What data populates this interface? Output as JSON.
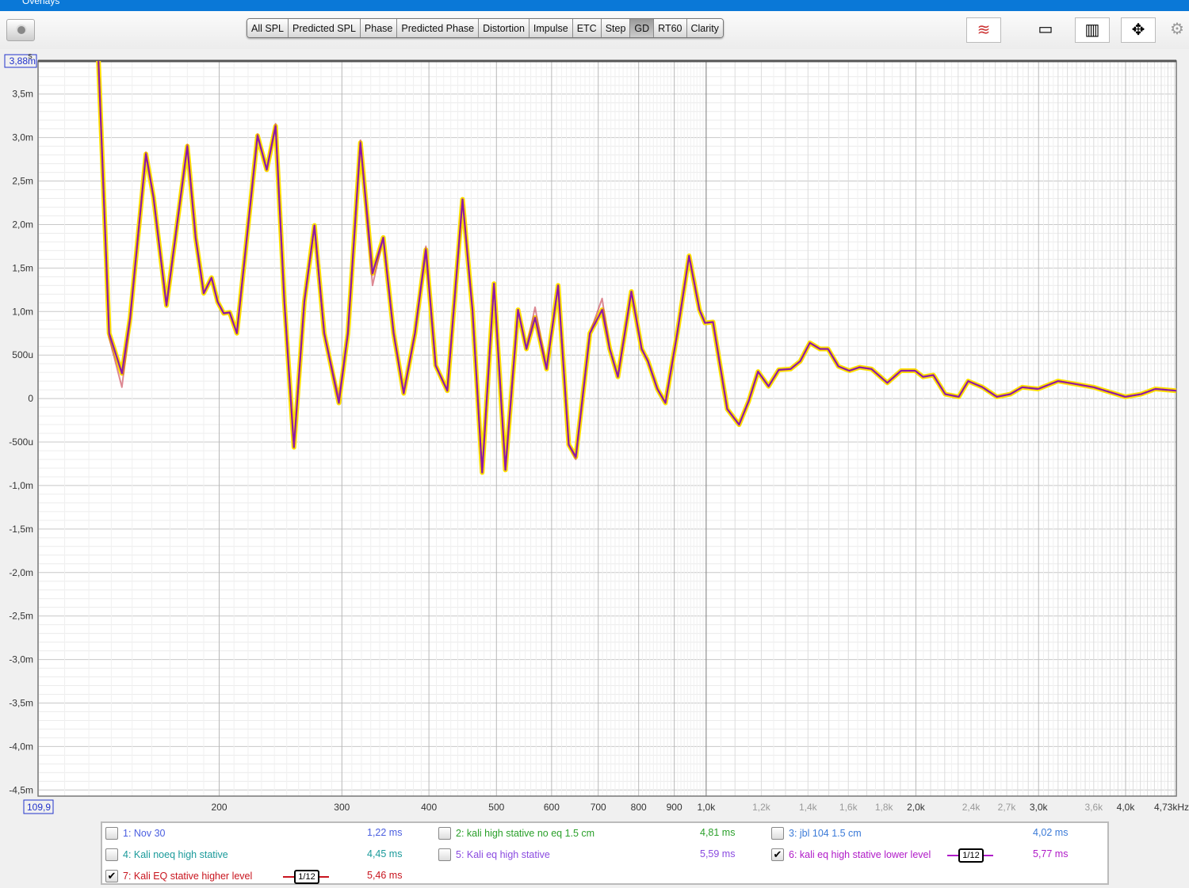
{
  "window": {
    "title": "Overlays"
  },
  "toolbar": {
    "tabs": [
      "All SPL",
      "Predicted SPL",
      "Phase",
      "Predicted Phase",
      "Distortion",
      "Impulse",
      "ETC",
      "Step",
      "GD",
      "RT60",
      "Clarity"
    ],
    "active": "GD"
  },
  "chart_data": {
    "type": "line",
    "x_scale": "log",
    "xlim": [
      109.9,
      4730
    ],
    "ylim": [
      -4.57,
      3.88
    ],
    "ylabel": "s",
    "grid": true,
    "x_ticks": [
      {
        "v": 109.9,
        "label": "109,9",
        "boxed": true
      },
      {
        "v": 200,
        "label": "200"
      },
      {
        "v": 300,
        "label": "300"
      },
      {
        "v": 400,
        "label": "400"
      },
      {
        "v": 500,
        "label": "500"
      },
      {
        "v": 600,
        "label": "600"
      },
      {
        "v": 700,
        "label": "700"
      },
      {
        "v": 800,
        "label": "800"
      },
      {
        "v": 900,
        "label": "900"
      },
      {
        "v": 1000,
        "label": "1,0k"
      },
      {
        "v": 1200,
        "label": "1,2k",
        "minor": true
      },
      {
        "v": 1400,
        "label": "1,4k",
        "minor": true
      },
      {
        "v": 1600,
        "label": "1,6k",
        "minor": true
      },
      {
        "v": 1800,
        "label": "1,8k",
        "minor": true
      },
      {
        "v": 2000,
        "label": "2,0k"
      },
      {
        "v": 2400,
        "label": "2,4k",
        "minor": true
      },
      {
        "v": 2700,
        "label": "2,7k",
        "minor": true
      },
      {
        "v": 3000,
        "label": "3,0k"
      },
      {
        "v": 3600,
        "label": "3,6k",
        "minor": true
      },
      {
        "v": 4000,
        "label": "4,0k"
      },
      {
        "v": 4730,
        "label": "4,73kHz"
      }
    ],
    "y_ticks": [
      {
        "v": 3.88,
        "label": "3,88m",
        "boxed": true
      },
      {
        "v": 3.5,
        "label": "3,5m"
      },
      {
        "v": 3.0,
        "label": "3,0m"
      },
      {
        "v": 2.5,
        "label": "2,5m"
      },
      {
        "v": 2.0,
        "label": "2,0m"
      },
      {
        "v": 1.5,
        "label": "1,5m"
      },
      {
        "v": 1.0,
        "label": "1,0m"
      },
      {
        "v": 0.5,
        "label": "500u"
      },
      {
        "v": 0,
        "label": "0"
      },
      {
        "v": -0.5,
        "label": "-500u"
      },
      {
        "v": -1.0,
        "label": "-1,0m"
      },
      {
        "v": -1.5,
        "label": "-1,5m"
      },
      {
        "v": -2.0,
        "label": "-2,0m"
      },
      {
        "v": -2.5,
        "label": "-2,5m"
      },
      {
        "v": -3.0,
        "label": "-3,0m"
      },
      {
        "v": -3.5,
        "label": "-3,5m"
      },
      {
        "v": -4.0,
        "label": "-4,0m"
      },
      {
        "v": -4.5,
        "label": "-4,5m"
      }
    ],
    "x": [
      134,
      139,
      145,
      149,
      157,
      161,
      168,
      173,
      180,
      185,
      190,
      195,
      199,
      203,
      207,
      212,
      227,
      234,
      241,
      248,
      256,
      265,
      274,
      283,
      297,
      306,
      319,
      332,
      344,
      356,
      368,
      382,
      396,
      409,
      425,
      447,
      462,
      477,
      496,
      515,
      537,
      552,
      568,
      590,
      613,
      635,
      650,
      681,
      709,
      727,
      747,
      781,
      808,
      825,
      851,
      874,
      909,
      945,
      978,
      996,
      1023,
      1072,
      1115,
      1151,
      1187,
      1229,
      1271,
      1322,
      1365,
      1409,
      1457,
      1496,
      1548,
      1605,
      1661,
      1727,
      1820,
      1904,
      1995,
      2048,
      2119,
      2204,
      2304,
      2377,
      2492,
      2614,
      2732,
      2842,
      2995,
      3199,
      3371,
      3598,
      3996,
      4210,
      4413,
      4727
    ],
    "series": [
      {
        "name": "7: Kali EQ stative higher level",
        "color": "#c83c4c",
        "ms": [
          4.0,
          0.7,
          0.13,
          0.9,
          2.83,
          2.31,
          1.07,
          1.85,
          2.92,
          1.85,
          1.21,
          1.39,
          1.11,
          0.98,
          0.99,
          0.75,
          3.04,
          2.63,
          3.16,
          1.12,
          -0.56,
          1.12,
          1.99,
          0.75,
          -0.0,
          0.75,
          2.97,
          1.3,
          1.85,
          0.75,
          0.06,
          0.75,
          1.75,
          0.38,
          0.09,
          2.29,
          1.01,
          -0.85,
          1.32,
          -0.8,
          1.02,
          0.57,
          1.05,
          0.34,
          1.3,
          -0.53,
          -0.7,
          0.75,
          1.15,
          0.57,
          0.25,
          1.23,
          0.57,
          0.43,
          0.11,
          -0.05,
          0.75,
          1.64,
          1.02,
          0.87,
          0.88,
          -0.12,
          -0.3,
          -0.03,
          0.31,
          0.14,
          0.33,
          0.34,
          0.43,
          0.64,
          0.57,
          0.57,
          0.37,
          0.32,
          0.36,
          0.34,
          0.18,
          0.32,
          0.32,
          0.25,
          0.27,
          0.05,
          0.02,
          0.2,
          0.13,
          0.02,
          0.05,
          0.13,
          0.11,
          0.2,
          0.17,
          0.13,
          0.02,
          0.05,
          0.11,
          0.09
        ]
      },
      {
        "name": "6: kali eq high stative lower level",
        "color": "#8e1aa6",
        "ms": [
          4.0,
          0.75,
          0.29,
          0.93,
          2.81,
          2.31,
          1.07,
          1.85,
          2.9,
          1.85,
          1.21,
          1.39,
          1.11,
          0.98,
          0.99,
          0.75,
          3.02,
          2.63,
          3.13,
          1.12,
          -0.56,
          1.12,
          1.99,
          0.75,
          -0.05,
          0.75,
          2.94,
          1.44,
          1.85,
          0.75,
          0.06,
          0.75,
          1.71,
          0.38,
          0.09,
          2.29,
          1.01,
          -0.85,
          1.32,
          -0.82,
          1.02,
          0.57,
          0.93,
          0.34,
          1.3,
          -0.53,
          -0.67,
          0.75,
          1.02,
          0.57,
          0.25,
          1.23,
          0.57,
          0.43,
          0.11,
          -0.05,
          0.75,
          1.64,
          1.02,
          0.87,
          0.88,
          -0.12,
          -0.3,
          -0.03,
          0.31,
          0.14,
          0.33,
          0.34,
          0.43,
          0.64,
          0.57,
          0.57,
          0.37,
          0.32,
          0.36,
          0.34,
          0.18,
          0.32,
          0.32,
          0.25,
          0.27,
          0.05,
          0.02,
          0.2,
          0.13,
          0.02,
          0.05,
          0.13,
          0.11,
          0.2,
          0.17,
          0.13,
          0.02,
          0.05,
          0.11,
          0.09
        ]
      }
    ]
  },
  "legend": [
    {
      "label": "1: Nov 30",
      "value": "1,22 ms",
      "color": "#4a5ee0",
      "checked": false
    },
    {
      "label": "2: kali high stative no eq 1.5 cm",
      "value": "4,81 ms",
      "color": "#2aa02a",
      "checked": false
    },
    {
      "label": "3: jbl 104 1.5 cm",
      "value": "4,02 ms",
      "color": "#3a7ad8",
      "checked": false
    },
    {
      "label": "4: Kali noeq high stative",
      "value": "4,45 ms",
      "color": "#1a9a9a",
      "checked": false
    },
    {
      "label": "5: Kali eq high stative",
      "value": "5,59 ms",
      "color": "#8a4ae0",
      "checked": false
    },
    {
      "label": "6: kali eq high stative lower level",
      "value": "5,77 ms",
      "color": "#b01ac8",
      "checked": true,
      "smoothing": "1/12"
    },
    {
      "label": "7: Kali EQ stative higher level",
      "value": "5,46 ms",
      "color": "#c8141e",
      "checked": true,
      "smoothing": "1/12"
    }
  ]
}
